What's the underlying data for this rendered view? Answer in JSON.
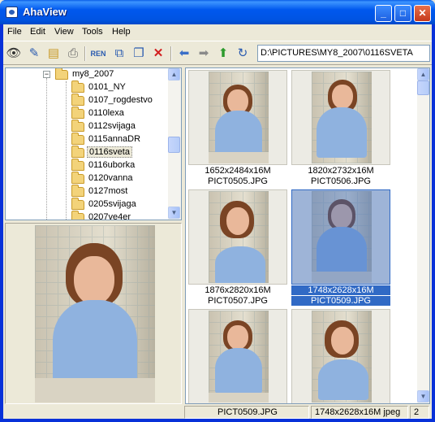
{
  "window": {
    "title": "AhaView",
    "minimize": "_",
    "maximize": "□",
    "close": "✕"
  },
  "menu": [
    "File",
    "Edit",
    "View",
    "Tools",
    "Help"
  ],
  "toolbar": {
    "icons": [
      "eye-icon",
      "pen-icon",
      "folder-properties-icon",
      "print-icon",
      "rename-icon",
      "move-icon",
      "copy-icon",
      "delete-icon",
      "back-arrow-icon",
      "forward-arrow-icon",
      "up-folder-icon",
      "refresh-icon"
    ],
    "path": "D:\\PICTURES\\MY8_2007\\0116SVETA"
  },
  "tree": {
    "parent": "my8_2007",
    "expander": "−",
    "folders": [
      "0101_NY",
      "0107_rogdestvo",
      "0110lexa",
      "0112svijaga",
      "0115annaDR",
      "0116sveta",
      "0116uborka",
      "0120vanna",
      "0127most",
      "0205svijaga",
      "0207ve4er"
    ],
    "selected_index": 5
  },
  "thumbnails": [
    {
      "dims": "1652x2484x16M",
      "name": "PICT0505.JPG",
      "selected": false
    },
    {
      "dims": "1820x2732x16M",
      "name": "PICT0506.JPG",
      "selected": false
    },
    {
      "dims": "1876x2820x16M",
      "name": "PICT0507.JPG",
      "selected": false
    },
    {
      "dims": "1748x2628x16M",
      "name": "PICT0509.JPG",
      "selected": true
    },
    {
      "dims": "",
      "name": "",
      "selected": false
    },
    {
      "dims": "",
      "name": "",
      "selected": false
    }
  ],
  "status": {
    "filename": "PICT0509.JPG",
    "info": "1748x2628x16M jpeg",
    "extra": "2"
  },
  "colors": {
    "selection": "#316ac5",
    "titlebar": "#0054e3"
  }
}
